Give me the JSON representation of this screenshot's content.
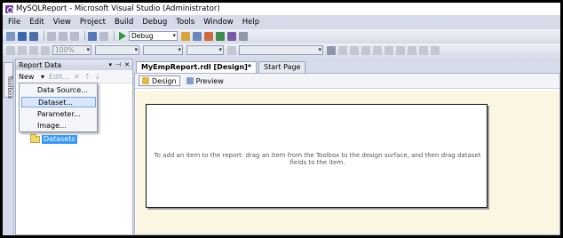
{
  "window": {
    "title": "MySQLReport - Microsoft Visual Studio (Administrator)"
  },
  "menu": [
    "File",
    "Edit",
    "View",
    "Project",
    "Build",
    "Debug",
    "Tools",
    "Window",
    "Help"
  ],
  "toolbar": {
    "config": "Debug",
    "zoom": "100%"
  },
  "toolbox": {
    "label": "Toolbox"
  },
  "report_data": {
    "title": "Report Data",
    "new_label": "New",
    "edit_label": "Edit...",
    "new_menu": [
      "Data Source...",
      "Dataset...",
      "Parameter...",
      "Image..."
    ],
    "highlighted": "Dataset...",
    "tree_item": "Datasets"
  },
  "doc_tabs": [
    "MyEmpReport.rdl [Design]*",
    "Start Page"
  ],
  "sub_tabs": [
    "Design",
    "Preview"
  ],
  "report": {
    "message": "To add an item to the report: drag an item from the Toolbox to the design surface, and then drag dataset fields to the item."
  },
  "colors": {
    "selection": "#3399ff",
    "menu_highlight": "#d7e6f8",
    "design_surface": "#fbf6e2"
  }
}
